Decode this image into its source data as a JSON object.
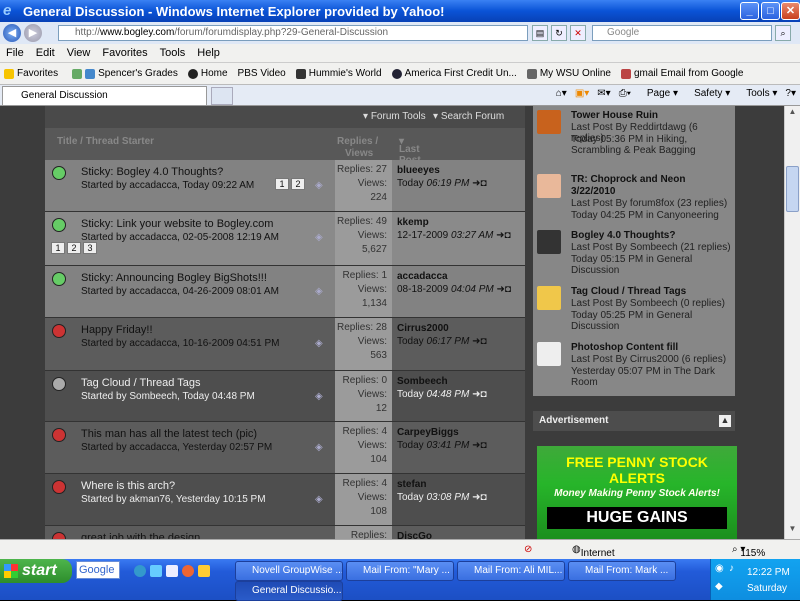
{
  "window": {
    "title": "General Discussion - Windows Internet Explorer provided by Yahoo!"
  },
  "address": {
    "url_domain": "www.bogley.com",
    "url_prefix": "http://",
    "url_rest": "/forum/forumdisplay.php?29-General-Discussion",
    "search_placeholder": "Google"
  },
  "menu": [
    "File",
    "Edit",
    "View",
    "Favorites",
    "Tools",
    "Help"
  ],
  "favorites": {
    "label": "Favorites",
    "items": [
      "Spencer's Grades",
      "Home",
      "PBS Video",
      "Hummie's World",
      "America First Credit Un...",
      "My WSU Online",
      "gmail Email from Google"
    ]
  },
  "tab": {
    "label": "General Discussion"
  },
  "cmdbar": {
    "page": "Page",
    "safety": "Safety",
    "tools": "Tools"
  },
  "forum": {
    "tools": {
      "forum_tools": "Forum Tools",
      "search_forum": "Search Forum"
    },
    "head": {
      "title": "Title / Thread Starter",
      "replies": "Replies /",
      "views": "Views",
      "last_post": "Last Post By"
    },
    "threads": [
      {
        "title": "Sticky: Bogley 4.0 Thoughts?",
        "starter": "Started by accadacca, Today 09:22 AM",
        "replies": "Replies: 27",
        "views_label": "Views:",
        "views": "224",
        "last_by": "blueeyes",
        "last_date": "Today",
        "last_time": "06:19 PM"
      },
      {
        "title": "Sticky: Link your website to Bogley.com",
        "starter": "Started by accadacca, 02-05-2008 12:19 AM",
        "replies": "Replies: 49",
        "views_label": "Views:",
        "views": "5,627",
        "last_by": "kkemp",
        "last_date": "12-17-2009",
        "last_time": "03:27 AM",
        "pages": [
          "1",
          "2",
          "3"
        ]
      },
      {
        "title": "Sticky: Announcing Bogley BigShots!!!",
        "starter": "Started by accadacca, 04-26-2009 08:01 AM",
        "replies": "Replies: 1",
        "views_label": "Views:",
        "views": "1,134",
        "last_by": "accadacca",
        "last_date": "08-18-2009",
        "last_time": "04:04 PM"
      },
      {
        "title": "Happy Friday!!",
        "starter": "Started by accadacca, 10-16-2009 04:51 PM",
        "replies": "Replies: 28",
        "views_label": "Views:",
        "views": "563",
        "last_by": "Cirrus2000",
        "last_date": "Today",
        "last_time": "06:17 PM"
      },
      {
        "title": "Tag Cloud / Thread Tags",
        "starter": "Started by Sombeech, Today 04:48 PM",
        "replies": "Replies: 0",
        "views_label": "Views:",
        "views": "12",
        "last_by": "Sombeech",
        "last_date": "Today",
        "last_time": "04:48 PM"
      },
      {
        "title": "This man has all the latest tech (pic)",
        "starter": "Started by accadacca, Yesterday 02:57 PM",
        "replies": "Replies: 4",
        "views_label": "Views:",
        "views": "104",
        "last_by": "CarpeyBiggs",
        "last_date": "Today",
        "last_time": "03:41 PM"
      },
      {
        "title": "Where is this arch?",
        "starter": "Started by akman76, Yesterday 10:15 PM",
        "replies": "Replies: 4",
        "views_label": "Views:",
        "views": "108",
        "last_by": "stefan",
        "last_date": "Today",
        "last_time": "03:08 PM"
      },
      {
        "title": "great job with the design",
        "starter": "",
        "replies": "Replies:",
        "views_label": "",
        "views": "",
        "last_by": "DiscGo",
        "last_date": "",
        "last_time": ""
      }
    ],
    "page_badges": [
      "1",
      "2"
    ]
  },
  "sidebar": {
    "items": [
      {
        "title": "Tower House Ruin",
        "line1": "Last Post By Reddirtdawg (6 replies)",
        "line2": "Today 05:36 PM in Hiking, Scrambling & Peak Bagging"
      },
      {
        "title": "TR: Choprock and Neon 3/22/2010",
        "line1": "Last Post By forum8fox (23 replies)",
        "line2": "Today 04:25 PM in Canyoneering"
      },
      {
        "title": "Bogley 4.0 Thoughts?",
        "line1": "Last Post By Sombeech (21 replies)",
        "line2": "Today 05:15 PM in General Discussion"
      },
      {
        "title": "Tag Cloud / Thread Tags",
        "line1": "Last Post By Sombeech (0 replies)",
        "line2": "Today 05:25 PM in General Discussion"
      },
      {
        "title": "Photoshop Content fill",
        "line1": "Last Post By Cirrus2000 (6 replies)",
        "line2": "Yesterday 05:07 PM in The Dark Room"
      }
    ],
    "ad_title": "Advertisement",
    "ad": {
      "line1": "FREE PENNY STOCK ALERTS",
      "line2": "Money Making Penny Stock Alerts!",
      "line3": "HUGE GAINS"
    }
  },
  "status": {
    "zone": "Internet",
    "zoom": "115%"
  },
  "taskbar": {
    "start": "start",
    "google": "Google",
    "buttons": [
      "Novell GroupWise ...",
      "Mail From: \"Mary ...",
      "Mail From: Ali MIL...",
      "Mail From: Mark ...",
      "General Discussio..."
    ],
    "time": "12:22 PM",
    "day": "Saturday"
  }
}
